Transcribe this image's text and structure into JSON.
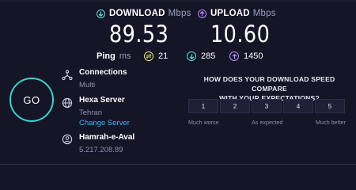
{
  "download": {
    "title": "DOWNLOAD",
    "unit": "Mbps",
    "value": "89.53",
    "icon": "download-arrow-icon",
    "color": "#5ce0d8"
  },
  "upload": {
    "title": "UPLOAD",
    "unit": "Mbps",
    "value": "10.60",
    "icon": "upload-arrow-icon",
    "color": "#b98cff"
  },
  "ping": {
    "title": "Ping",
    "unit": "ms",
    "idle": "21",
    "download": "285",
    "upload": "1450",
    "idle_color": "#e8e26a"
  },
  "go_button": {
    "label": "GO",
    "color": "#35d5cc"
  },
  "connections": {
    "title": "Connections",
    "value": "Multi",
    "icon": "connections-icon"
  },
  "server": {
    "title": "Hexa Server",
    "location": "Tehran",
    "change_label": "Change Server",
    "icon": "globe-icon",
    "link_color": "#2fb9f4"
  },
  "provider": {
    "title": "Hamrah-e-Aval",
    "ip": "5.217.208.89",
    "icon": "user-icon"
  },
  "survey": {
    "question_line1": "HOW DOES YOUR DOWNLOAD SPEED COMPARE",
    "question_line2": "WITH YOUR EXPECTATIONS?",
    "options": [
      "1",
      "2",
      "3",
      "4",
      "5"
    ],
    "low_label": "Much worse",
    "mid_label": "As expected",
    "high_label": "Much better"
  }
}
